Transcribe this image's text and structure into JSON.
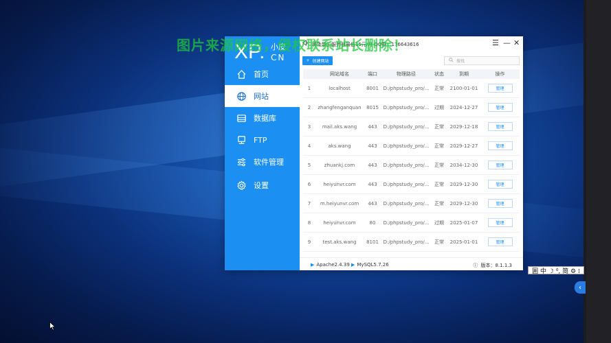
{
  "watermark": "图片来源网络，侵权联系站长删除！",
  "logo": {
    "main": "XP",
    "dot": ".",
    "small": "小皮",
    "cn": "CN"
  },
  "nav": [
    {
      "label": "首页",
      "icon": "home-icon",
      "active": false
    },
    {
      "label": "网站",
      "icon": "globe-icon",
      "active": true
    },
    {
      "label": "数据库",
      "icon": "database-icon",
      "active": false
    },
    {
      "label": "FTP",
      "icon": "server-icon",
      "active": false
    },
    {
      "label": "软件管理",
      "icon": "sliders-icon",
      "active": false
    },
    {
      "label": "设置",
      "icon": "gear-icon",
      "active": false
    }
  ],
  "topbar": {
    "notice": "腾牲能云服务器最低15元/月   QQ群：176643616",
    "window_controls": {
      "menu": "☰",
      "minimize": "—",
      "close": "✕"
    }
  },
  "toolbar": {
    "create_label": "创建网站",
    "create_plus": "+",
    "search_placeholder": "搜找"
  },
  "table": {
    "headers": [
      "",
      "网站域名",
      "端口",
      "物理路径",
      "状态",
      "到期",
      "操作"
    ],
    "rows": [
      [
        "1",
        "localhost",
        "8001",
        "D:/phpstudy_pro/...",
        "正常",
        "2100-01-01",
        "管理"
      ],
      [
        "2",
        "zhangfenganquan",
        "8015",
        "D:/phpstudy_pro/...",
        "过期",
        "2024-12-27",
        "管理"
      ],
      [
        "3",
        "mail.aks.wang",
        "443",
        "D:/phpstudy_pro/...",
        "正常",
        "2029-12-18",
        "管理"
      ],
      [
        "4",
        "aks.wang",
        "443",
        "D:/phpstudy_pro/...",
        "正常",
        "2029-12-27",
        "管理"
      ],
      [
        "5",
        "zhuankj.com",
        "443",
        "D:/phpstudy_pro/...",
        "正常",
        "2034-12-30",
        "管理"
      ],
      [
        "6",
        "heiyunvr.com",
        "443",
        "D:/phpstudy_pro/...",
        "正常",
        "2029-12-30",
        "管理"
      ],
      [
        "7",
        "m.heiyunvr.com",
        "443",
        "D:/phpstudy_pro/...",
        "正常",
        "2029-12-30",
        "管理"
      ],
      [
        "8",
        "heiyunvr.com",
        "80",
        "D:/phpstudy_pro/...",
        "过期",
        "2025-01-07",
        "管理"
      ],
      [
        "9",
        "test.aks.wang",
        "8101",
        "D:/phpstudy_pro/...",
        "正常",
        "2025-01-01",
        "管理"
      ]
    ]
  },
  "footer": {
    "apache": "Apache2.4.39",
    "mysql": "MySQL5.7.26",
    "version": "版本：8.1.1.3"
  },
  "ime": {
    "text": "囲 中 ☽ ⁰, 简 ⚙ ⁞"
  },
  "colors": {
    "accent": "#1b8ff2",
    "sidebar": "#1b8ff2",
    "watermark": "#1ec83c"
  }
}
